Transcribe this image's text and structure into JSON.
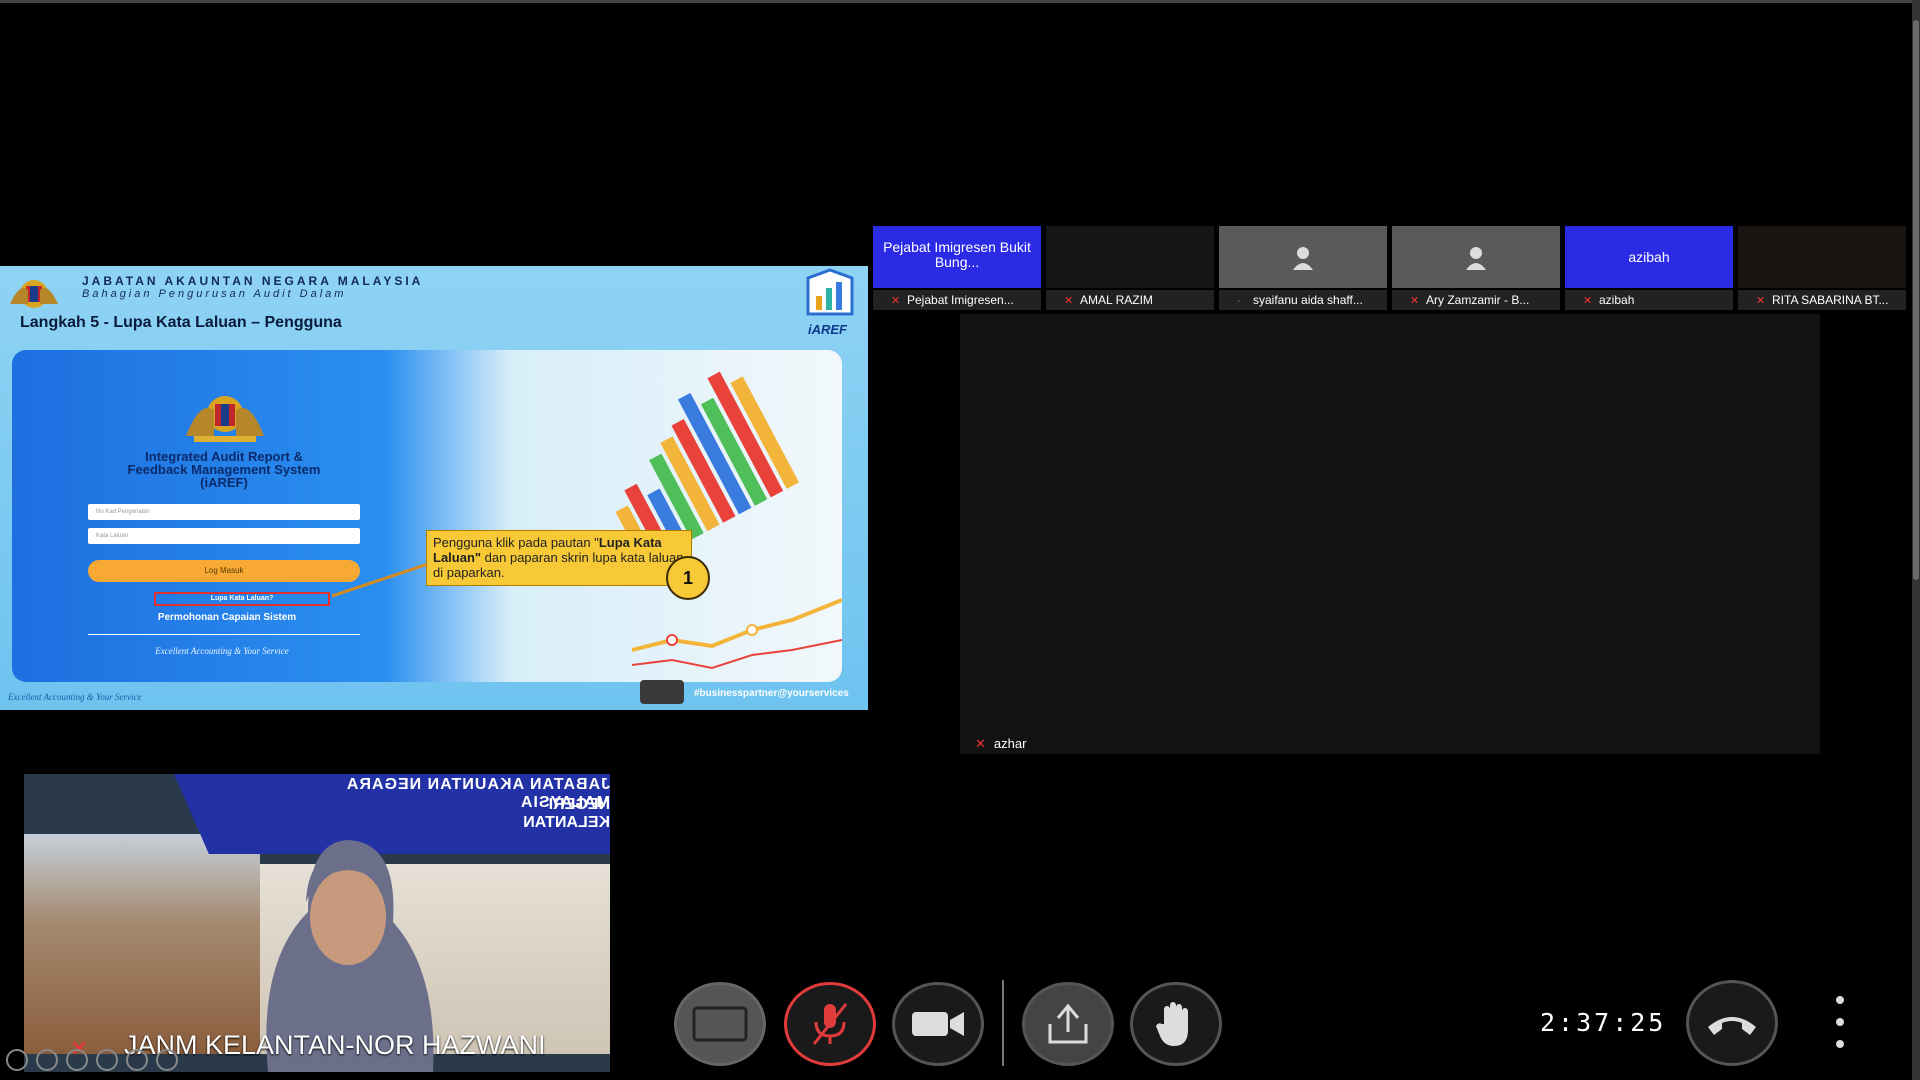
{
  "slide": {
    "org_name": "JABATAN AKAUNTAN NEGARA MALAYSIA",
    "org_division": "Bahagian Pengurusan Audit Dalam",
    "title": "Langkah 5 - Lupa Kata Laluan – Pengguna",
    "logo_text": "iAREF",
    "system_name_line1": "Integrated Audit Report &",
    "system_name_line2": "Feedback Management System",
    "system_name_line3": "(iAREF)",
    "input1_placeholder": "No Kad Pengenalan",
    "input2_placeholder": "Kata Laluan",
    "login_label": "Log Masuk",
    "forgot_link": "Lupa Kata Laluan?",
    "request_link": "Permohonan Capaian Sistem",
    "motto_card": "Excellent Accounting & Your Service",
    "callout_pre": "Pengguna klik pada pautan \"",
    "callout_bold": "Lupa Kata Laluan\"",
    "callout_post": " dan paparan skrin lupa kata laluan di paparkan.",
    "step_badge": "1",
    "motto_footer": "Excellent Accounting & Your Service",
    "hashtag": "#businesspartner@yourservices"
  },
  "participants": [
    {
      "tile_text": "Pejabat Imigresen Bukit Bung...",
      "name": "Pejabat Imigresen...",
      "muted": true,
      "bg": "#2b2be6"
    },
    {
      "tile_text": "",
      "name": "AMAL RAZIM",
      "muted": true,
      "bg": "#161616"
    },
    {
      "tile_text": "",
      "name": "syaifanu aida shaff...",
      "muted": false,
      "bg": "#5a5a5a"
    },
    {
      "tile_text": "",
      "name": "Ary Zamzamir - B...",
      "muted": true,
      "bg": "#5a5a5a"
    },
    {
      "tile_text": "azibah",
      "name": "azibah",
      "muted": true,
      "bg": "#2b2be6"
    },
    {
      "tile_text": "",
      "name": "RITA SABARINA BT...",
      "muted": true,
      "bg": "#1a1512"
    }
  ],
  "main_speaker": {
    "name": "azhar"
  },
  "self_view": {
    "banner_line1": "JABATAN AKAUNTAN NEGARA MALAYSIA",
    "banner_line2": "NEGERI KELANTAN",
    "name": "JANM KELANTAN-NOR HAZWANI"
  },
  "controls": {
    "clock": "2:37:25",
    "layout_icon": "layout-icon",
    "mic_icon": "mic-muted-icon",
    "camera_icon": "camera-icon",
    "share_icon": "share-screen-icon",
    "hand_icon": "raise-hand-icon",
    "hangup_icon": "hang-up-icon",
    "more_icon": "more-vertical-icon"
  }
}
